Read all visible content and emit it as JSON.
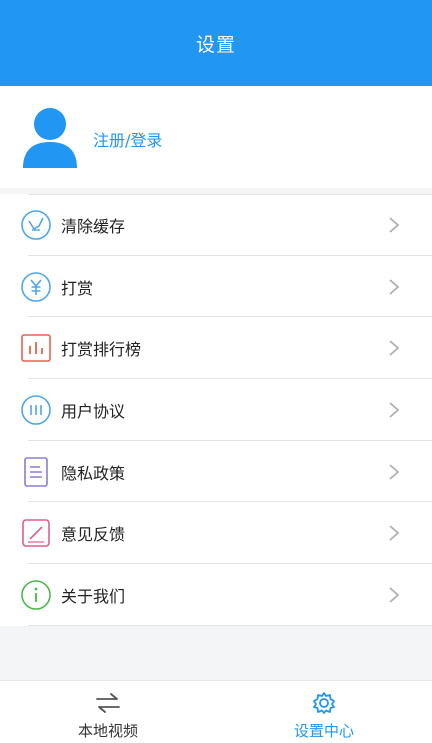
{
  "header": {
    "title": "设置"
  },
  "profile": {
    "avatar_icon": "user-avatar-icon",
    "login_label": "注册/登录"
  },
  "menu": {
    "items": [
      {
        "label": "清除缓存",
        "icon": "broom-clear-icon",
        "color": "#4da6e8"
      },
      {
        "label": "打赏",
        "icon": "yen-coin-icon",
        "color": "#4da6e8"
      },
      {
        "label": "打赏排行榜",
        "icon": "bar-chart-icon",
        "color": "#e8604f"
      },
      {
        "label": "用户协议",
        "icon": "agreement-icon",
        "color": "#4da6e8"
      },
      {
        "label": "隐私政策",
        "icon": "document-icon",
        "color": "#8b7bd8"
      },
      {
        "label": "意见反馈",
        "icon": "edit-feedback-icon",
        "color": "#e85a8c"
      },
      {
        "label": "关于我们",
        "icon": "info-icon",
        "color": "#4cb84c"
      }
    ]
  },
  "tabs": [
    {
      "label": "本地视频",
      "icon": "swap-arrows-icon",
      "active": false
    },
    {
      "label": "设置中心",
      "icon": "gear-icon",
      "active": true
    }
  ],
  "colors": {
    "primary": "#2196f3",
    "text": "#222222",
    "chevron": "#b0b0b0"
  }
}
